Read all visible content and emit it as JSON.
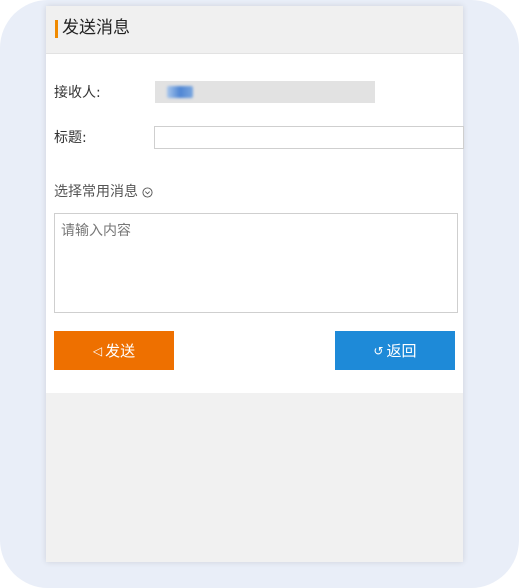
{
  "header": {
    "title": "发送消息"
  },
  "form": {
    "receiver_label": "接收人:",
    "title_label": "标题:",
    "title_value": "",
    "common_message_label": "选择常用消息",
    "content_placeholder": "请输入内容",
    "content_value": ""
  },
  "buttons": {
    "send_icon": "◁",
    "send_label": "发送",
    "back_icon": "↺",
    "back_label": "返回"
  },
  "colors": {
    "accent": "#f08a00",
    "send_button": "#ee7000",
    "back_button": "#1e8ad8"
  },
  "icons": {
    "chevron": "chevron-down-circle-icon",
    "send": "send-icon",
    "back": "return-icon"
  }
}
